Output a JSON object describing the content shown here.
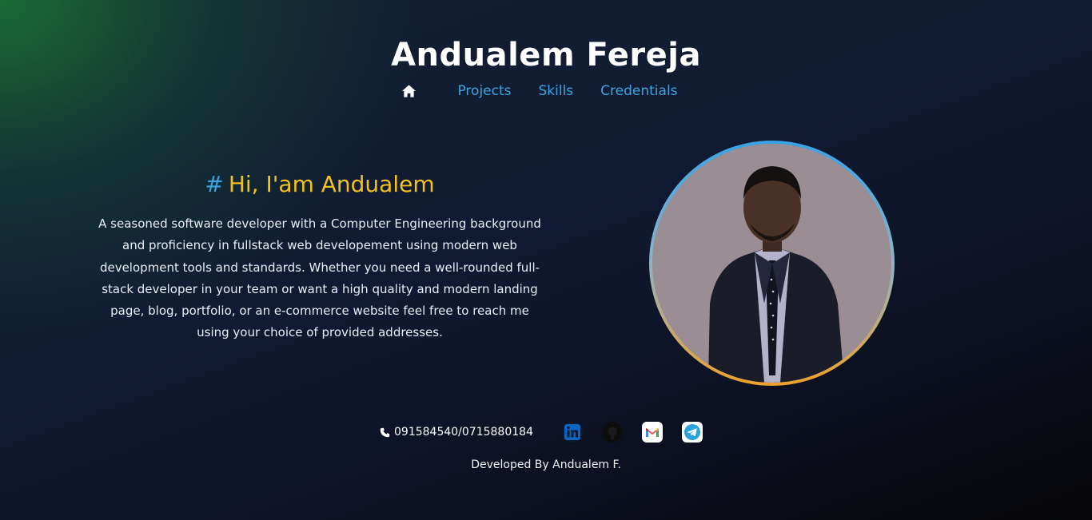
{
  "header": {
    "title": "Andualem Fereja",
    "nav": {
      "home_icon": "home-icon",
      "items": [
        {
          "label": "Projects"
        },
        {
          "label": "Skills"
        },
        {
          "label": "Credentials"
        }
      ]
    }
  },
  "intro": {
    "hash": "#",
    "heading": "Hi, I'am Andualem",
    "bio": "A seasoned software developer with a Computer Engineering background and proficiency in fullstack web developement using modern web development tools and standards. Whether you need a well-rounded full-stack developer in your team or want a high quality and modern landing page, blog, portfolio, or an e-commerce website feel free to reach me using your choice of provided addresses."
  },
  "profile": {
    "photo_icon": "profile-photo"
  },
  "contacts": {
    "phone": "091584540/0715880184",
    "links": [
      {
        "icon": "linkedin-icon"
      },
      {
        "icon": "github-icon"
      },
      {
        "icon": "gmail-icon"
      },
      {
        "icon": "telegram-icon"
      }
    ]
  },
  "footer": {
    "text": "Developed By Andualem F."
  },
  "colors": {
    "accent_blue": "#3aa5e0",
    "accent_yellow": "#f2c21a",
    "ring_orange": "#f0a12a"
  }
}
